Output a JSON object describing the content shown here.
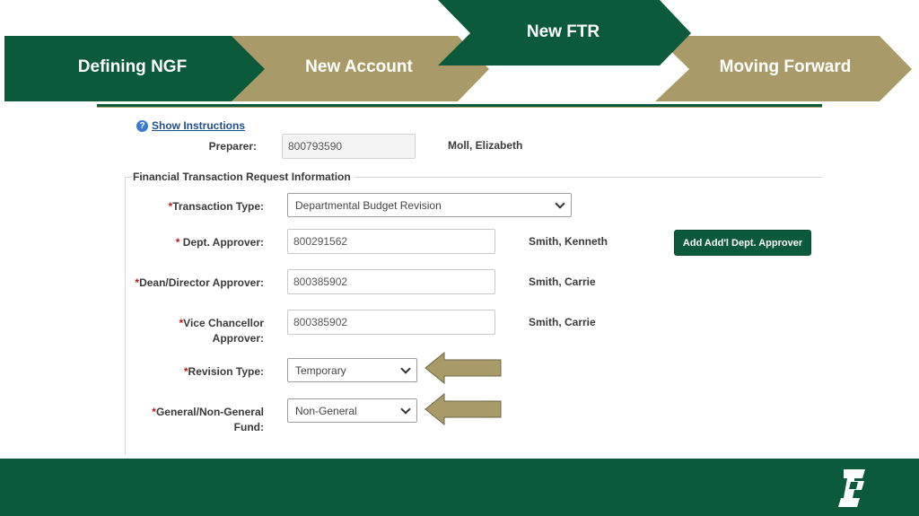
{
  "banner": {
    "steps": [
      {
        "label": "Defining NGF"
      },
      {
        "label": "New Account"
      },
      {
        "label": "New FTR"
      },
      {
        "label": "Moving Forward"
      }
    ],
    "colors": {
      "green": "#0b5a3b",
      "gold": "#a99b68"
    }
  },
  "form": {
    "show_instructions": "Show Instructions",
    "help_icon": "?",
    "preparer": {
      "label": "Preparer:",
      "value": "800793590",
      "name": "Moll, Elizabeth"
    },
    "section_title": "Financial Transaction Request Information",
    "transaction_type": {
      "label": "Transaction Type:",
      "value": "Departmental Budget Revision"
    },
    "dept_approver": {
      "label": " Dept. Approver:",
      "value": "800291562",
      "name": "Smith, Kenneth"
    },
    "add_button": "Add Add'l Dept. Approver",
    "dean_approver": {
      "label": "Dean/Director Approver:",
      "value": "800385902",
      "name": "Smith, Carrie"
    },
    "vc_approver": {
      "label_line1": "Vice Chancellor",
      "label_line2": "Approver:",
      "value": "800385902",
      "name": "Smith, Carrie"
    },
    "revision_type": {
      "label": "Revision Type:",
      "value": "Temporary"
    },
    "fund": {
      "label_line1": "General/Non-General",
      "label_line2": "Fund:",
      "value": "Non-General"
    },
    "required_mark": "*"
  },
  "footer": {
    "logo_icon": "unc-charlotte-c-logo-icon",
    "arrow_icon": "left-arrow-icon"
  }
}
